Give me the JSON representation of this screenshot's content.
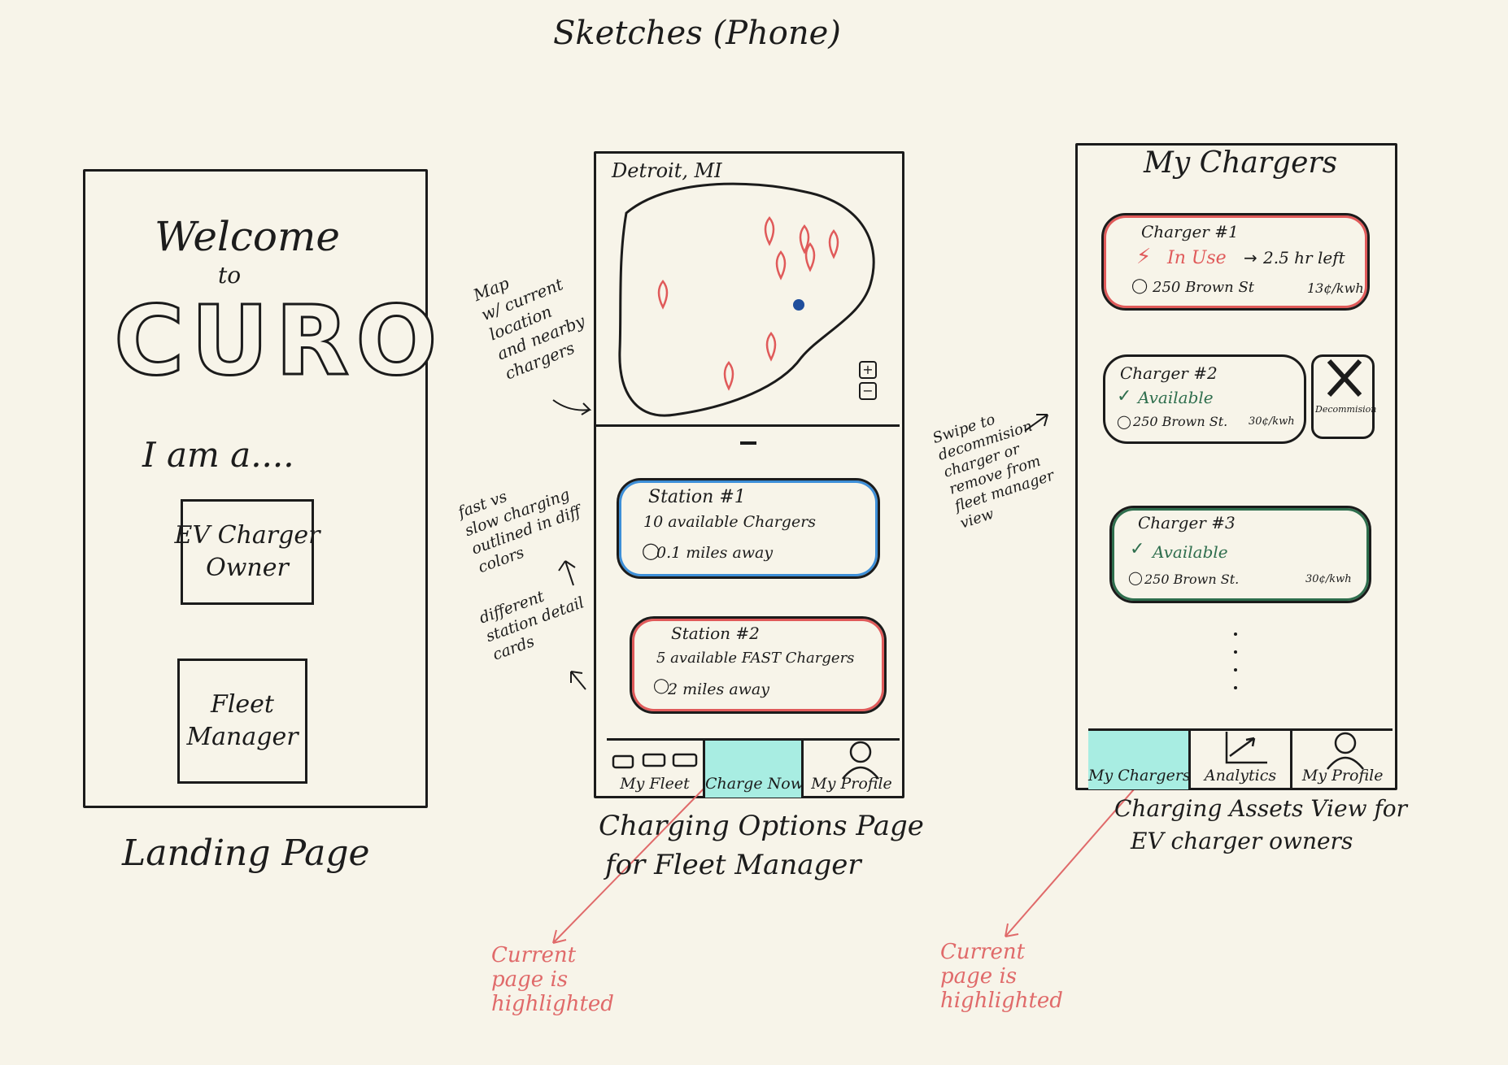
{
  "page_title": "Sketches (Phone)",
  "landing": {
    "welcome": "Welcome",
    "to": "to",
    "brand": "CURO",
    "iam": "I am a....",
    "owner_button": "EV Charger\nOwner",
    "fleet_button": "Fleet\nManager",
    "caption": "Landing Page"
  },
  "charging": {
    "city": "Detroit, MI",
    "zoom_in": "+",
    "zoom_out": "−",
    "stations": [
      {
        "name": "Station #1",
        "chargers": "10 available Chargers",
        "distance": "0.1 miles away",
        "outline": "#3d8fd8"
      },
      {
        "name": "Station #2",
        "chargers": "5 available FAST Chargers",
        "distance": "2 miles away",
        "outline": "#e05a5a"
      }
    ],
    "tabs": [
      "My Fleet",
      "Charge Now",
      "My Profile"
    ],
    "active_tab": "Charge Now",
    "caption_line1": "Charging Options Page",
    "caption_line2": "for Fleet Manager"
  },
  "chargers": {
    "title": "My Chargers",
    "items": [
      {
        "name": "Charger #1",
        "status": "In Use",
        "time_left": "2.5 hr left",
        "address": "250 Brown St",
        "price": "13¢/kwh",
        "status_color": "#e05a5a"
      },
      {
        "name": "Charger #2",
        "status": "Available",
        "address": "250 Brown St.",
        "price": "30¢/kwh",
        "status_color": "#2e6e4d"
      },
      {
        "name": "Charger #3",
        "status": "Available",
        "address": "250 Brown St.",
        "price": "30¢/kwh",
        "status_color": "#2e6e4d"
      }
    ],
    "decommission": "Decommision",
    "tabs": [
      "My Chargers",
      "Analytics",
      "My Profile"
    ],
    "active_tab": "My Chargers",
    "caption_line1": "Charging Assets View for",
    "caption_line2": "EV charger owners"
  },
  "annotations": {
    "map_note": [
      "Map",
      "w/ current",
      "location",
      "and nearby",
      "chargers"
    ],
    "speed_note": [
      "fast vs",
      "slow charging",
      "outlined in diff",
      "colors"
    ],
    "cards_note": [
      "different",
      "station detail",
      "cards"
    ],
    "swipe_note": [
      "Swipe to",
      "decommision",
      "charger or",
      "remove from",
      "fleet manager",
      "view"
    ],
    "highlight_note": [
      "Current",
      "page is",
      "highlighted"
    ]
  },
  "colors": {
    "background": "#f7f4e9",
    "ink": "#1b1b1b",
    "highlight": "#a8ede2",
    "annotation_red": "#e06a6a",
    "blue_outline": "#3d8fd8",
    "red_outline": "#e05a5a",
    "green_outline": "#2e6e4d",
    "location_dot": "#1f4e9c"
  }
}
